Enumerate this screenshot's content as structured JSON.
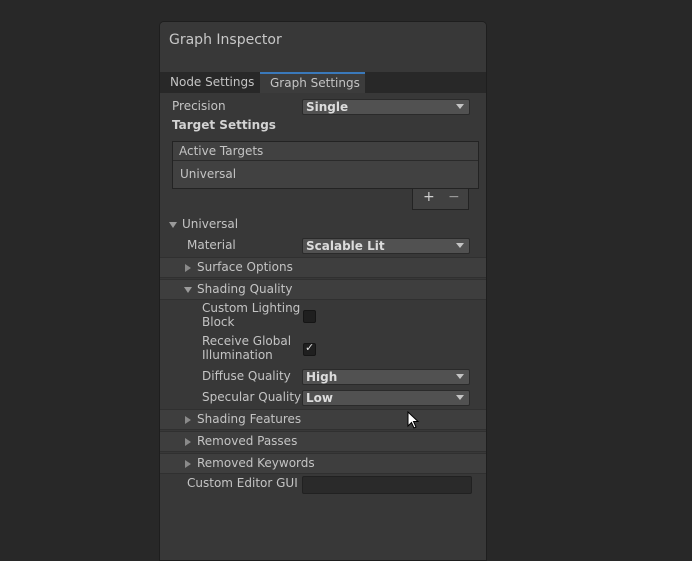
{
  "window": {
    "title": "Graph Inspector"
  },
  "tabs": [
    {
      "label": "Node Settings",
      "active": false
    },
    {
      "label": "Graph Settings",
      "active": true
    }
  ],
  "precision": {
    "label": "Precision",
    "value": "Single"
  },
  "target_settings": {
    "heading": "Target Settings",
    "list_header": "Active Targets",
    "items": [
      "Universal"
    ],
    "add_label": "+",
    "remove_label": "−"
  },
  "universal": {
    "label": "Universal",
    "material": {
      "label": "Material",
      "value": "Scalable Lit"
    },
    "surface_options": {
      "label": "Surface Options",
      "expanded": false
    },
    "shading_quality": {
      "label": "Shading Quality",
      "expanded": true,
      "custom_lighting_block": {
        "label_line1": "Custom Lighting",
        "label_line2": "Block",
        "checked": false
      },
      "receive_global_illumination": {
        "label_line1": "Receive Global",
        "label_line2": "Illumination",
        "checked": true,
        "mark": "✓"
      },
      "diffuse_quality": {
        "label": "Diffuse Quality",
        "value": "High"
      },
      "specular_quality": {
        "label": "Specular Quality",
        "value": "Low"
      }
    },
    "shading_features": {
      "label": "Shading Features",
      "expanded": false
    },
    "removed_passes": {
      "label": "Removed Passes",
      "expanded": false
    },
    "removed_keywords": {
      "label": "Removed Keywords",
      "expanded": false
    }
  },
  "custom_editor_gui": {
    "label": "Custom Editor GUI",
    "value": ""
  },
  "colors": {
    "accent": "#3a79bb",
    "panel": "#383838",
    "background": "#282828"
  }
}
